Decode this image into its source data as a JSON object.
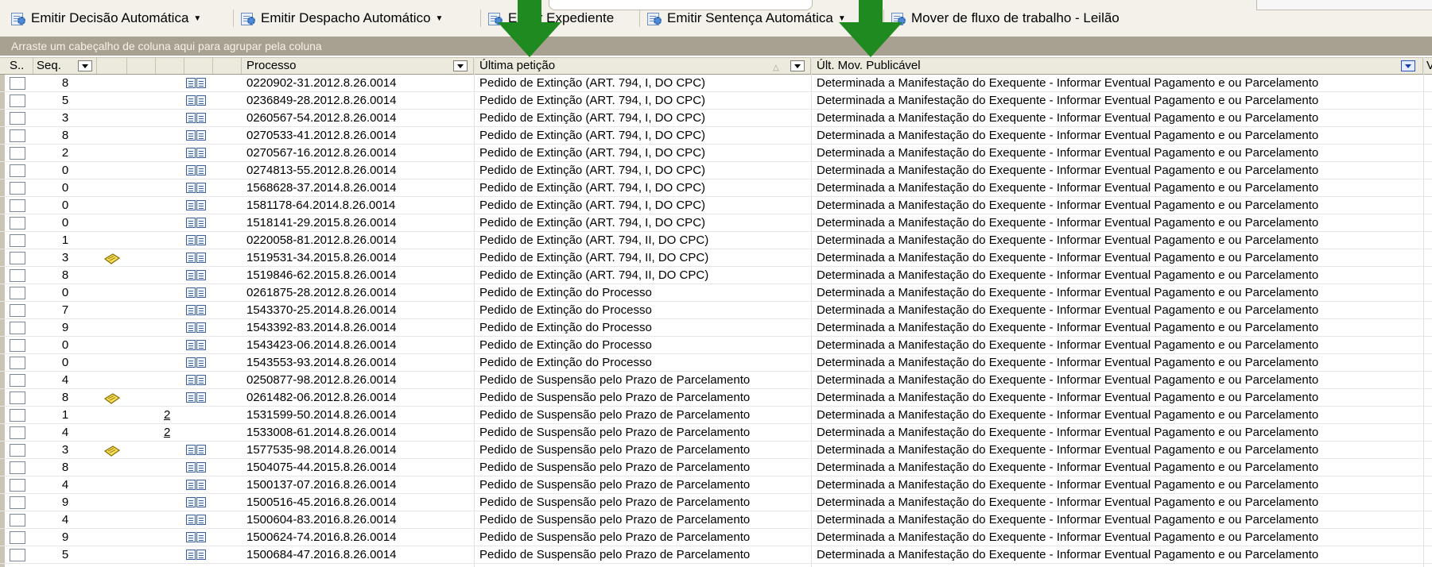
{
  "toolbar": {
    "items": [
      {
        "label": "Emitir Decisão Automática",
        "has_menu": true
      },
      {
        "label": "Emitir Despacho Automático",
        "has_menu": true
      },
      {
        "label": "Emitir Expediente",
        "has_menu": false
      },
      {
        "label": "Emitir Sentença Automática",
        "has_menu": true
      },
      {
        "label": "Mover de fluxo de trabalho - Leilão",
        "has_menu": false
      }
    ]
  },
  "group_bar": {
    "text": "Arraste um cabeçalho de coluna aqui para agrupar pela coluna"
  },
  "columns": {
    "select": "S..",
    "seq": "Seq.",
    "processo": "Processo",
    "ultima_peticao": "Última petição",
    "ult_mov": "Últ. Mov. Publicável",
    "extra": "V"
  },
  "colors": {
    "accent_arrow": "#1f8a1f",
    "group_bar": "#a8a090",
    "header": "#ece9dd"
  },
  "rows": [
    {
      "seq": "8",
      "note": false,
      "link": "",
      "processo": "0220902-31.2012.8.26.0014",
      "peticao": "Pedido de Extinção  (ART. 794, I, DO CPC)",
      "mov": "Determinada a Manifestação do Exequente - Informar Eventual Pagamento e ou Parcelamento"
    },
    {
      "seq": "5",
      "note": false,
      "link": "",
      "processo": "0236849-28.2012.8.26.0014",
      "peticao": "Pedido de Extinção  (ART. 794, I, DO CPC)",
      "mov": "Determinada a Manifestação do Exequente - Informar Eventual Pagamento e ou Parcelamento"
    },
    {
      "seq": "3",
      "note": false,
      "link": "",
      "processo": "0260567-54.2012.8.26.0014",
      "peticao": "Pedido de Extinção  (ART. 794, I, DO CPC)",
      "mov": "Determinada a Manifestação do Exequente - Informar Eventual Pagamento e ou Parcelamento"
    },
    {
      "seq": "8",
      "note": false,
      "link": "",
      "processo": "0270533-41.2012.8.26.0014",
      "peticao": "Pedido de Extinção  (ART. 794, I, DO CPC)",
      "mov": "Determinada a Manifestação do Exequente - Informar Eventual Pagamento e ou Parcelamento"
    },
    {
      "seq": "2",
      "note": false,
      "link": "",
      "processo": "0270567-16.2012.8.26.0014",
      "peticao": "Pedido de Extinção  (ART. 794, I, DO CPC)",
      "mov": "Determinada a Manifestação do Exequente - Informar Eventual Pagamento e ou Parcelamento"
    },
    {
      "seq": "0",
      "note": false,
      "link": "",
      "processo": "0274813-55.2012.8.26.0014",
      "peticao": "Pedido de Extinção  (ART. 794, I, DO CPC)",
      "mov": "Determinada a Manifestação do Exequente - Informar Eventual Pagamento e ou Parcelamento"
    },
    {
      "seq": "0",
      "note": false,
      "link": "",
      "processo": "1568628-37.2014.8.26.0014",
      "peticao": "Pedido de Extinção  (ART. 794, I, DO CPC)",
      "mov": "Determinada a Manifestação do Exequente - Informar Eventual Pagamento e ou Parcelamento"
    },
    {
      "seq": "0",
      "note": false,
      "link": "",
      "processo": "1581178-64.2014.8.26.0014",
      "peticao": "Pedido de Extinção  (ART. 794, I, DO CPC)",
      "mov": "Determinada a Manifestação do Exequente - Informar Eventual Pagamento e ou Parcelamento"
    },
    {
      "seq": "0",
      "note": false,
      "link": "",
      "processo": "1518141-29.2015.8.26.0014",
      "peticao": "Pedido de Extinção  (ART. 794, I, DO CPC)",
      "mov": "Determinada a Manifestação do Exequente - Informar Eventual Pagamento e ou Parcelamento"
    },
    {
      "seq": "1",
      "note": false,
      "link": "",
      "processo": "0220058-81.2012.8.26.0014",
      "peticao": "Pedido de Extinção  (ART. 794, II, DO CPC)",
      "mov": "Determinada a Manifestação do Exequente - Informar Eventual Pagamento e ou Parcelamento"
    },
    {
      "seq": "3",
      "note": true,
      "link": "",
      "processo": "1519531-34.2015.8.26.0014",
      "peticao": "Pedido de Extinção  (ART. 794, II, DO CPC)",
      "mov": "Determinada a Manifestação do Exequente - Informar Eventual Pagamento e ou Parcelamento"
    },
    {
      "seq": "8",
      "note": false,
      "link": "",
      "processo": "1519846-62.2015.8.26.0014",
      "peticao": "Pedido de Extinção  (ART. 794, II, DO CPC)",
      "mov": "Determinada a Manifestação do Exequente - Informar Eventual Pagamento e ou Parcelamento"
    },
    {
      "seq": "0",
      "note": false,
      "link": "",
      "processo": "0261875-28.2012.8.26.0014",
      "peticao": "Pedido de Extinção do Processo",
      "mov": "Determinada a Manifestação do Exequente - Informar Eventual Pagamento e ou Parcelamento"
    },
    {
      "seq": "7",
      "note": false,
      "link": "",
      "processo": "1543370-25.2014.8.26.0014",
      "peticao": "Pedido de Extinção do Processo",
      "mov": "Determinada a Manifestação do Exequente - Informar Eventual Pagamento e ou Parcelamento"
    },
    {
      "seq": "9",
      "note": false,
      "link": "",
      "processo": "1543392-83.2014.8.26.0014",
      "peticao": "Pedido de Extinção do Processo",
      "mov": "Determinada a Manifestação do Exequente - Informar Eventual Pagamento e ou Parcelamento"
    },
    {
      "seq": "0",
      "note": false,
      "link": "",
      "processo": "1543423-06.2014.8.26.0014",
      "peticao": "Pedido de Extinção do Processo",
      "mov": "Determinada a Manifestação do Exequente - Informar Eventual Pagamento e ou Parcelamento"
    },
    {
      "seq": "0",
      "note": false,
      "link": "",
      "processo": "1543553-93.2014.8.26.0014",
      "peticao": "Pedido de Extinção do Processo",
      "mov": "Determinada a Manifestação do Exequente - Informar Eventual Pagamento e ou Parcelamento"
    },
    {
      "seq": "4",
      "note": false,
      "link": "",
      "processo": "0250877-98.2012.8.26.0014",
      "peticao": "Pedido de Suspensão pelo Prazo de Parcelamento",
      "mov": "Determinada a Manifestação do Exequente - Informar Eventual Pagamento e ou Parcelamento"
    },
    {
      "seq": "8",
      "note": true,
      "link": "",
      "processo": "0261482-06.2012.8.26.0014",
      "peticao": "Pedido de Suspensão pelo Prazo de Parcelamento",
      "mov": "Determinada a Manifestação do Exequente - Informar Eventual Pagamento e ou Parcelamento"
    },
    {
      "seq": "1",
      "note": false,
      "link": "2",
      "processo": "1531599-50.2014.8.26.0014",
      "peticao": "Pedido de Suspensão pelo Prazo de Parcelamento",
      "mov": "Determinada a Manifestação do Exequente - Informar Eventual Pagamento e ou Parcelamento"
    },
    {
      "seq": "4",
      "note": false,
      "link": "2",
      "processo": "1533008-61.2014.8.26.0014",
      "peticao": "Pedido de Suspensão pelo Prazo de Parcelamento",
      "mov": "Determinada a Manifestação do Exequente - Informar Eventual Pagamento e ou Parcelamento"
    },
    {
      "seq": "3",
      "note": true,
      "link": "",
      "processo": "1577535-98.2014.8.26.0014",
      "peticao": "Pedido de Suspensão pelo Prazo de Parcelamento",
      "mov": "Determinada a Manifestação do Exequente - Informar Eventual Pagamento e ou Parcelamento"
    },
    {
      "seq": "8",
      "note": false,
      "link": "",
      "processo": "1504075-44.2015.8.26.0014",
      "peticao": "Pedido de Suspensão pelo Prazo de Parcelamento",
      "mov": "Determinada a Manifestação do Exequente - Informar Eventual Pagamento e ou Parcelamento"
    },
    {
      "seq": "4",
      "note": false,
      "link": "",
      "processo": "1500137-07.2016.8.26.0014",
      "peticao": "Pedido de Suspensão pelo Prazo de Parcelamento",
      "mov": "Determinada a Manifestação do Exequente - Informar Eventual Pagamento e ou Parcelamento"
    },
    {
      "seq": "9",
      "note": false,
      "link": "",
      "processo": "1500516-45.2016.8.26.0014",
      "peticao": "Pedido de Suspensão pelo Prazo de Parcelamento",
      "mov": "Determinada a Manifestação do Exequente - Informar Eventual Pagamento e ou Parcelamento"
    },
    {
      "seq": "4",
      "note": false,
      "link": "",
      "processo": "1500604-83.2016.8.26.0014",
      "peticao": "Pedido de Suspensão pelo Prazo de Parcelamento",
      "mov": "Determinada a Manifestação do Exequente - Informar Eventual Pagamento e ou Parcelamento"
    },
    {
      "seq": "9",
      "note": false,
      "link": "",
      "processo": "1500624-74.2016.8.26.0014",
      "peticao": "Pedido de Suspensão pelo Prazo de Parcelamento",
      "mov": "Determinada a Manifestação do Exequente - Informar Eventual Pagamento e ou Parcelamento"
    },
    {
      "seq": "5",
      "note": false,
      "link": "",
      "processo": "1500684-47.2016.8.26.0014",
      "peticao": "Pedido de Suspensão pelo Prazo de Parcelamento",
      "mov": "Determinada a Manifestação do Exequente - Informar Eventual Pagamento e ou Parcelamento"
    }
  ]
}
